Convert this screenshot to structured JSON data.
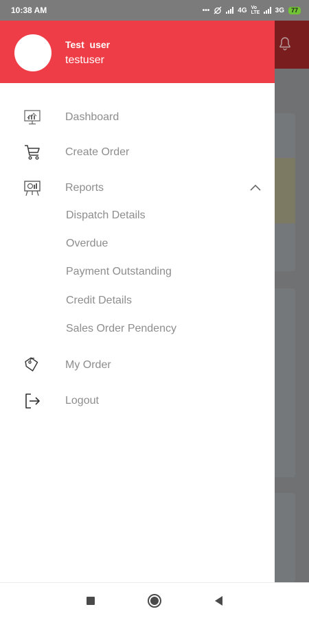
{
  "status_bar": {
    "time": "10:38 AM",
    "net_4g": "4G",
    "net_volte": "Vo LTE",
    "net_3g": "3G",
    "battery": "77"
  },
  "drawer": {
    "user_name": "Test  user",
    "user_id": "testuser"
  },
  "menu": {
    "dashboard": "Dashboard",
    "create_order": "Create Order",
    "reports": "Reports",
    "reports_sub": [
      "Dispatch Details",
      "Overdue",
      "Payment Outstanding",
      "Credit Details",
      "Sales Order Pendency"
    ],
    "my_order": "My Order",
    "logout": "Logout"
  },
  "icons": {
    "dashboard": "dashboard-monitor-icon",
    "create_order": "cart-icon",
    "reports": "presentation-board-icon",
    "reports_expand": "chevron-up-icon",
    "my_order": "tag-icon",
    "logout": "logout-icon",
    "notification": "bell-icon"
  },
  "colors": {
    "header_red": "#ee3d46",
    "text_gray": "#8d8d8d",
    "scrim": "#6f7173"
  }
}
